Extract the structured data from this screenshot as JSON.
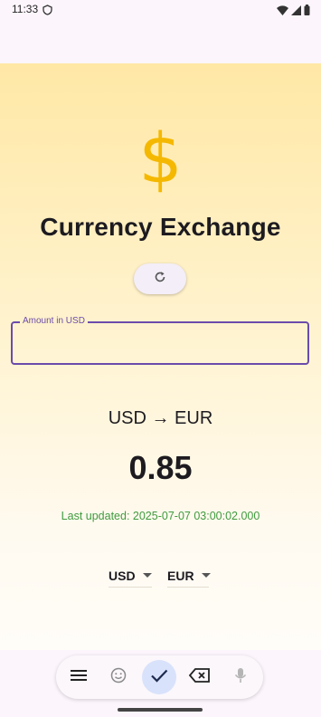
{
  "status_bar": {
    "time": "11:33"
  },
  "app": {
    "title": "Currency Exchange",
    "dollar_symbol": "$",
    "refresh_icon": "refresh-icon"
  },
  "amount_field": {
    "label": "Amount in USD",
    "value": ""
  },
  "conversion": {
    "pair": "USD → EUR",
    "rate": "0.85",
    "last_updated": "Last updated: 2025-07-07 03:00:02.000"
  },
  "selectors": {
    "from": "USD",
    "to": "EUR"
  },
  "keyboard_toolbar": {
    "items": [
      "menu-icon",
      "emoji-icon",
      "check-icon",
      "backspace-icon",
      "mic-icon"
    ]
  },
  "colors": {
    "accent": "#6b4bab",
    "dollar": "#f5b800",
    "updated_text": "#3f9b3f"
  }
}
